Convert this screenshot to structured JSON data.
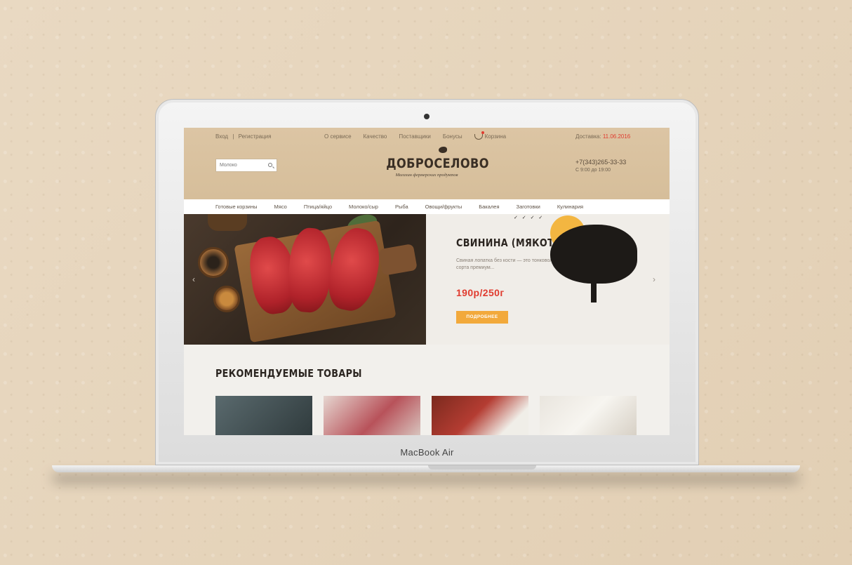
{
  "device": {
    "brand_label": "MacBook Air"
  },
  "site": {
    "topbar": {
      "login": "Вход",
      "separator": "|",
      "register": "Регистрация",
      "links": [
        "О сервисе",
        "Качество",
        "Поставщики",
        "Бонусы"
      ],
      "cart_label": "Корзина",
      "delivery_label": "Доставка:",
      "delivery_date": "11.06.2016"
    },
    "search": {
      "value": "Молоко"
    },
    "logo": {
      "title": "ДОБРОСЕЛОВО",
      "subtitle": "Магазин фермерских продуктов"
    },
    "contact": {
      "phone": "+7(343)265-33-33",
      "hours": "С 9:00 до 19:00"
    },
    "categories": [
      "Готовые корзины",
      "Мясо",
      "Птица/яйцо",
      "Молоко/сыр",
      "Рыба",
      "Овощи/фрукты",
      "Бакалея",
      "Заготовки",
      "Кулинария"
    ],
    "hero": {
      "title": "СВИНИНА (МЯКОТЬ)",
      "description": "Свиная лопатка без кости — это тонковолокнистое нежирное мясо сорта премиум...",
      "price": "190р/250г",
      "button_label": "ПОДРОБНЕЕ",
      "prev_arrow": "‹",
      "next_arrow": "›"
    },
    "section_title": "РЕКОМЕНДУЕМЫЕ ТОВАРЫ"
  }
}
